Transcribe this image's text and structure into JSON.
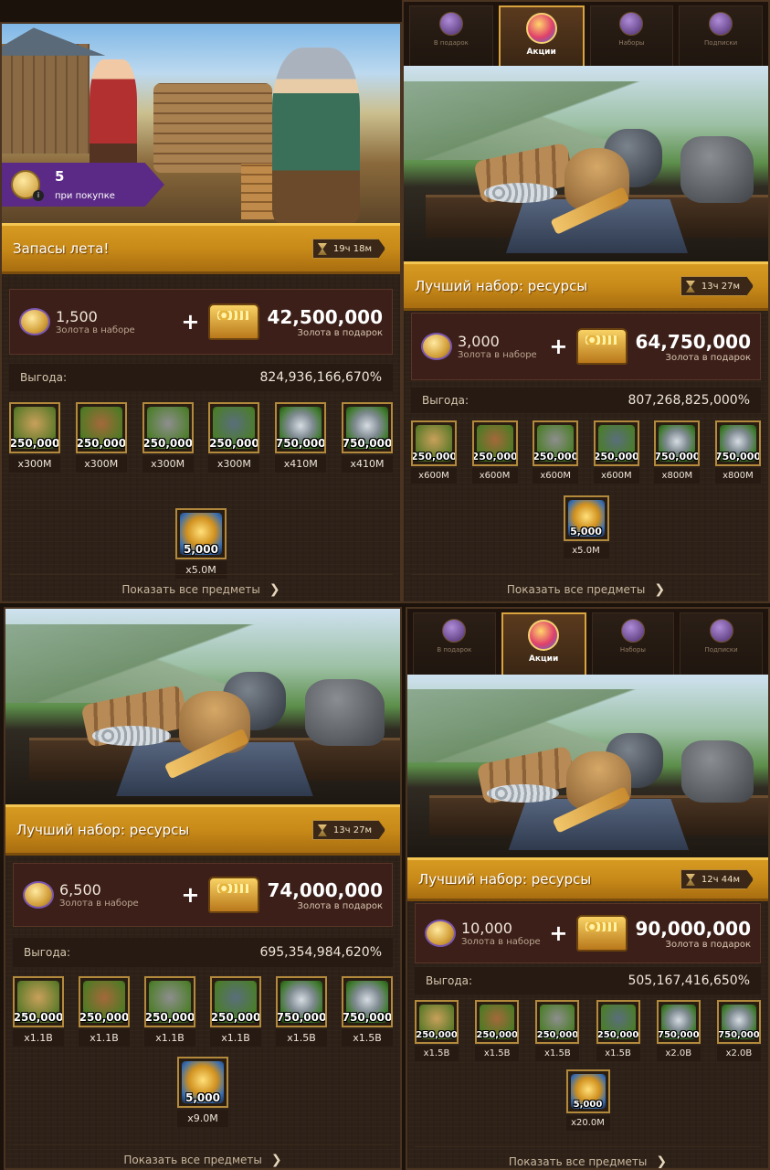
{
  "panels": [
    {
      "id": "p1",
      "tabs": null,
      "banner_scene": "village",
      "promo": {
        "value": "5",
        "label": "при покупке"
      },
      "title": "Запасы лета!",
      "timer": "19ч 18м",
      "gold": {
        "value": "1,500",
        "label": "Золота в наборе"
      },
      "gift": {
        "value": "42,500,000",
        "label": "Золота в подарок"
      },
      "benefit": {
        "label": "Выгода:",
        "value": "824,936,166,670%"
      },
      "items": [
        {
          "icon": "food-basket-icon",
          "art": "food",
          "qty": "250,000",
          "mult": "x300M"
        },
        {
          "icon": "wood-logs-icon",
          "art": "wood",
          "qty": "250,000",
          "mult": "x300M"
        },
        {
          "icon": "stone-icon",
          "art": "stone",
          "qty": "250,000",
          "mult": "x300M"
        },
        {
          "icon": "iron-ore-icon",
          "art": "iron",
          "qty": "250,000",
          "mult": "x300M"
        },
        {
          "icon": "silver-coins-icon",
          "art": "silver",
          "qty": "750,000",
          "mult": "x410M"
        },
        {
          "icon": "silver-coins-icon",
          "art": "silver",
          "qty": "750,000",
          "mult": "x410M"
        }
      ],
      "extra_item": {
        "icon": "gold-coins-icon",
        "art": "gold",
        "qty": "5,000",
        "mult": "x5.0M"
      },
      "show_all": "Показать все предметы"
    },
    {
      "id": "p2",
      "tabs": [
        "В подарок",
        "Акции",
        "Наборы",
        "Подписки"
      ],
      "active_tab": 1,
      "banner_scene": "table",
      "title": "Лучший набор: ресурсы",
      "timer": "13ч 27м",
      "gold": {
        "value": "3,000",
        "label": "Золота в наборе"
      },
      "gift": {
        "value": "64,750,000",
        "label": "Золота в подарок"
      },
      "benefit": {
        "label": "Выгода:",
        "value": "807,268,825,000%"
      },
      "items": [
        {
          "icon": "food-basket-icon",
          "art": "food",
          "qty": "250,000",
          "mult": "x600M"
        },
        {
          "icon": "wood-logs-icon",
          "art": "wood",
          "qty": "250,000",
          "mult": "x600M"
        },
        {
          "icon": "stone-icon",
          "art": "stone",
          "qty": "250,000",
          "mult": "x600M"
        },
        {
          "icon": "iron-ore-icon",
          "art": "iron",
          "qty": "250,000",
          "mult": "x600M"
        },
        {
          "icon": "silver-coins-icon",
          "art": "silver",
          "qty": "750,000",
          "mult": "x800M"
        },
        {
          "icon": "silver-coins-icon",
          "art": "silver",
          "qty": "750,000",
          "mult": "x800M"
        }
      ],
      "extra_item": {
        "icon": "gold-coins-icon",
        "art": "gold",
        "qty": "5,000",
        "mult": "x5.0M"
      },
      "show_all": "Показать все предметы"
    },
    {
      "id": "p3",
      "tabs": null,
      "banner_scene": "table",
      "title": "Лучший набор: ресурсы",
      "timer": "13ч 27м",
      "gold": {
        "value": "6,500",
        "label": "Золота в наборе"
      },
      "gift": {
        "value": "74,000,000",
        "label": "Золота в подарок"
      },
      "benefit": {
        "label": "Выгода:",
        "value": "695,354,984,620%"
      },
      "items": [
        {
          "icon": "food-basket-icon",
          "art": "food",
          "qty": "250,000",
          "mult": "x1.1B"
        },
        {
          "icon": "wood-logs-icon",
          "art": "wood",
          "qty": "250,000",
          "mult": "x1.1B"
        },
        {
          "icon": "stone-icon",
          "art": "stone",
          "qty": "250,000",
          "mult": "x1.1B"
        },
        {
          "icon": "iron-ore-icon",
          "art": "iron",
          "qty": "250,000",
          "mult": "x1.1B"
        },
        {
          "icon": "silver-coins-icon",
          "art": "silver",
          "qty": "750,000",
          "mult": "x1.5B"
        },
        {
          "icon": "silver-coins-icon",
          "art": "silver",
          "qty": "750,000",
          "mult": "x1.5B"
        }
      ],
      "extra_item": {
        "icon": "gold-coins-icon",
        "art": "gold",
        "qty": "5,000",
        "mult": "x9.0M"
      },
      "show_all": "Показать все предметы"
    },
    {
      "id": "p4",
      "tabs": [
        "В подарок",
        "Акции",
        "Наборы",
        "Подписки"
      ],
      "active_tab": 1,
      "banner_scene": "table",
      "title": "Лучший набор: ресурсы",
      "timer": "12ч 44м",
      "gold": {
        "value": "10,000",
        "label": "Золота в наборе"
      },
      "gift": {
        "value": "90,000,000",
        "label": "Золота в подарок"
      },
      "benefit": {
        "label": "Выгода:",
        "value": "505,167,416,650%"
      },
      "items": [
        {
          "icon": "food-basket-icon",
          "art": "food",
          "qty": "250,000",
          "mult": "x1.5B"
        },
        {
          "icon": "wood-logs-icon",
          "art": "wood",
          "qty": "250,000",
          "mult": "x1.5B"
        },
        {
          "icon": "stone-icon",
          "art": "stone",
          "qty": "250,000",
          "mult": "x1.5B"
        },
        {
          "icon": "iron-ore-icon",
          "art": "iron",
          "qty": "250,000",
          "mult": "x1.5B"
        },
        {
          "icon": "silver-coins-icon",
          "art": "silver",
          "qty": "750,000",
          "mult": "x2.0B"
        },
        {
          "icon": "silver-coins-icon",
          "art": "silver",
          "qty": "750,000",
          "mult": "x2.0B"
        }
      ],
      "extra_item": {
        "icon": "gold-coins-icon",
        "art": "gold",
        "qty": "5,000",
        "mult": "x20.0M"
      },
      "show_all": "Показать все предметы"
    }
  ]
}
